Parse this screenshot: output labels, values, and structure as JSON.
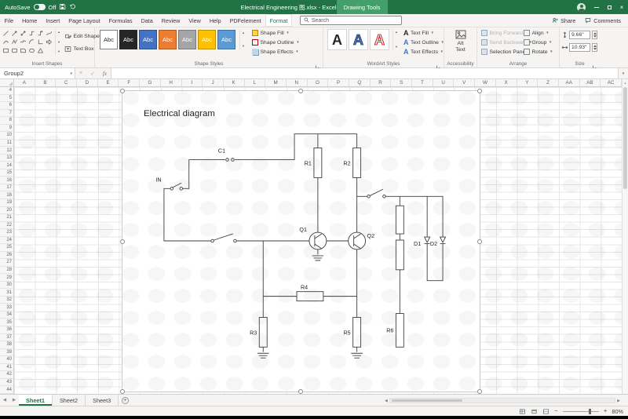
{
  "colors": {
    "accent": "#217346",
    "contextual_tab_bg": "#43a06c"
  },
  "icons": {
    "dropdown": "▾",
    "scroll_up": "▴",
    "scroll_down": "▾",
    "cancel": "×",
    "enter": "✓",
    "formula_expand": "▾",
    "sheet_nav_left": "◀",
    "sheet_nav_right": "▶",
    "add_sheet": "+",
    "zoom_out": "−",
    "zoom_in": "+",
    "close": "×",
    "scrollbar_up": "▲",
    "hscroll_left": "◀",
    "hscroll_right": "▶"
  },
  "titlebar": {
    "autosave": "AutoSave",
    "autosave_state": "Off",
    "title": "Electrical Engineering 图.xlsx - Excel",
    "context_tab": "Drawing Tools"
  },
  "menu": {
    "tabs": [
      "File",
      "Home",
      "Insert",
      "Page Layout",
      "Formulas",
      "Data",
      "Review",
      "View",
      "Help",
      "PDFelement",
      "Format"
    ],
    "active": "Format",
    "search": "Search",
    "share": "Share",
    "comments": "Comments"
  },
  "ribbon": {
    "insert_shapes": {
      "label": "Insert Shapes",
      "icon_rows": [
        [
          "line",
          "line-arrow",
          "double-arrow",
          "elbow-connector",
          "elbow-arrow",
          "curved-connector"
        ],
        [
          "curve",
          "freeform",
          "scribble",
          "arc",
          "l-shape",
          "block-arrow"
        ],
        [
          "rectangle",
          "rounded-rectangle",
          "snip-rectangle",
          "oval",
          "triangle"
        ]
      ],
      "edit_shape": "Edit Shape",
      "text_box": "Text Box"
    },
    "shape_styles": {
      "label": "Shape Styles",
      "sample": "Abc",
      "gallery": [
        {
          "fill": "#ffffff",
          "text": "#262626",
          "border": "#7f7f7f"
        },
        {
          "fill": "#262626",
          "text": "#ffffff",
          "border": "#262626"
        },
        {
          "fill": "#4472c4",
          "text": "#ffffff",
          "border": "#2f528f"
        },
        {
          "fill": "#ed7d31",
          "text": "#ffffff",
          "border": "#ae5a21"
        },
        {
          "fill": "#a5a5a5",
          "text": "#ffffff",
          "border": "#7b7b7b"
        },
        {
          "fill": "#ffc000",
          "text": "#ffffff",
          "border": "#bf9000"
        },
        {
          "fill": "#5b9bd5",
          "text": "#ffffff",
          "border": "#41719c"
        }
      ],
      "buttons": [
        {
          "label": "Shape Fill"
        },
        {
          "label": "Shape Outline"
        },
        {
          "label": "Shape Effects"
        }
      ]
    },
    "wordart": {
      "label": "WordArt Styles",
      "sample": "A",
      "gallery": [
        {
          "fill": "#262626",
          "stroke": "none"
        },
        {
          "fill": "#4472c4",
          "stroke": "#323f66"
        },
        {
          "fill": "#ffffff",
          "stroke": "#c00000"
        }
      ],
      "buttons": [
        {
          "label": "Text Fill",
          "color": "#262626"
        },
        {
          "label": "Text Outline",
          "color": "#4472c4"
        },
        {
          "label": "Text Effects",
          "color": "#4472c4"
        }
      ]
    },
    "accessibility": {
      "label": "Accessibility",
      "alt_text": "Alt Text"
    },
    "arrange": {
      "label": "Arrange",
      "left": [
        {
          "label": "Bring Forward",
          "disabled": true,
          "arrow": true
        },
        {
          "label": "Send Backward",
          "disabled": true,
          "arrow": true
        },
        {
          "label": "Selection Pane",
          "disabled": false,
          "arrow": false
        }
      ],
      "right": [
        {
          "label": "Align"
        },
        {
          "label": "Group"
        },
        {
          "label": "Rotate"
        }
      ]
    },
    "size": {
      "label": "Size",
      "height": "9.66\"",
      "width": "10.93\""
    }
  },
  "formula": {
    "name_box": "Group2",
    "fx": "fx"
  },
  "grid": {
    "columns": [
      "A",
      "B",
      "C",
      "D",
      "E",
      "F",
      "G",
      "H",
      "I",
      "J",
      "K",
      "L",
      "M",
      "N",
      "O",
      "P",
      "Q",
      "R",
      "S",
      "T",
      "U",
      "V",
      "W",
      "X",
      "Y",
      "Z",
      "AA",
      "AB",
      "AC"
    ],
    "row_start": 4,
    "row_end": 44
  },
  "diagram": {
    "title": "Electrical diagram",
    "labels": {
      "c1": "C1",
      "in": "IN",
      "r1": "R1",
      "r2": "R2",
      "q1": "Q1",
      "q2": "Q2",
      "d1": "D1",
      "d2": "D2",
      "r3": "R3",
      "r4": "R4",
      "r5": "R5",
      "r6": "R6"
    }
  },
  "sheet_tabs": {
    "tabs": [
      "Sheet1",
      "Sheet2",
      "Sheet3"
    ],
    "active": "Sheet1"
  },
  "status": {
    "zoom": "80%"
  }
}
